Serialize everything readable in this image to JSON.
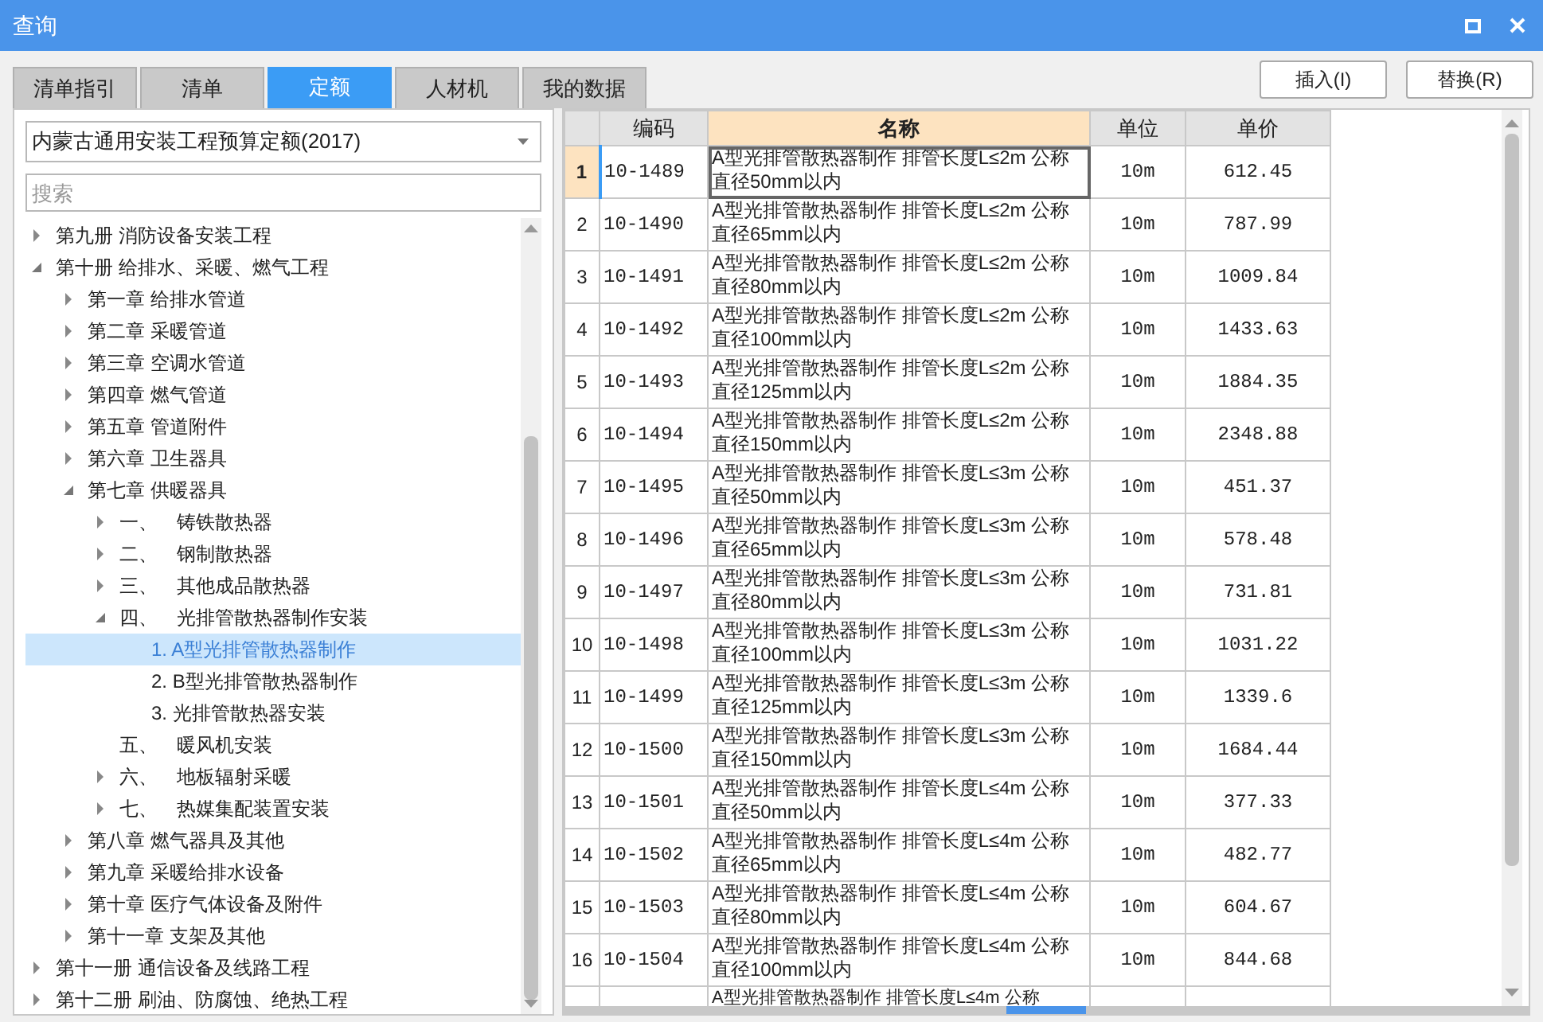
{
  "window": {
    "title": "查询"
  },
  "tabs": [
    {
      "label": "清单指引",
      "selected": false
    },
    {
      "label": "清单",
      "selected": false
    },
    {
      "label": "定额",
      "selected": true
    },
    {
      "label": "人材机",
      "selected": false
    },
    {
      "label": "我的数据",
      "selected": false
    }
  ],
  "buttons": [
    "插入(I)",
    "替换(R)"
  ],
  "library_select": {
    "value": "内蒙古通用安装工程预算定额(2017)"
  },
  "search": {
    "placeholder": "搜索"
  },
  "tree": [
    {
      "label": "第九册 消防设备安装工程",
      "expanded": false,
      "selected": false
    },
    {
      "label": "第十册 给排水、采暖、燃气工程",
      "expanded": true,
      "selected": false,
      "children": [
        {
          "label": "第一章 给排水管道",
          "expanded": false,
          "selected": false
        },
        {
          "label": "第二章 采暖管道",
          "expanded": false,
          "selected": false
        },
        {
          "label": "第三章 空调水管道",
          "expanded": false,
          "selected": false
        },
        {
          "label": "第四章 燃气管道",
          "expanded": false,
          "selected": false
        },
        {
          "label": "第五章 管道附件",
          "expanded": false,
          "selected": false
        },
        {
          "label": "第六章 卫生器具",
          "expanded": false,
          "selected": false
        },
        {
          "label": "第七章 供暖器具",
          "expanded": true,
          "selected": false,
          "children": [
            {
              "label": "一、　铸铁散热器",
              "expanded": false,
              "selected": false
            },
            {
              "label": "二、　钢制散热器",
              "expanded": false,
              "selected": false
            },
            {
              "label": "三、　其他成品散热器",
              "expanded": false,
              "selected": false
            },
            {
              "label": "四、　光排管散热器制作安装",
              "expanded": true,
              "selected": false,
              "children": [
                {
                  "label": "1. A型光排管散热器制作",
                  "selected": true
                },
                {
                  "label": "2. B型光排管散热器制作",
                  "selected": false
                },
                {
                  "label": "3. 光排管散热器安装",
                  "selected": false
                }
              ]
            },
            {
              "label": "五、　暖风机安装",
              "selected": false
            },
            {
              "label": "六、　地板辐射采暖",
              "expanded": false,
              "selected": false
            },
            {
              "label": "七、　热媒集配装置安装",
              "expanded": false,
              "selected": false
            }
          ]
        },
        {
          "label": "第八章 燃气器具及其他",
          "expanded": false,
          "selected": false
        },
        {
          "label": "第九章 采暖给排水设备",
          "expanded": false,
          "selected": false
        },
        {
          "label": "第十章 医疗气体设备及附件",
          "expanded": false,
          "selected": false
        },
        {
          "label": "第十一章 支架及其他",
          "expanded": false,
          "selected": false
        }
      ]
    },
    {
      "label": "第十一册 通信设备及线路工程",
      "expanded": false,
      "selected": false
    },
    {
      "label": "第十二册 刷油、防腐蚀、绝热工程",
      "expanded": false,
      "selected": false
    }
  ],
  "table": {
    "columns": [
      "编码",
      "名称",
      "单位",
      "单价"
    ],
    "rows": [
      {
        "no": "1",
        "code": "10-1489",
        "name": "A型光排管散热器制作 排管长度L≤2m 公称直径50mm以内",
        "unit": "10m",
        "price": "612.45",
        "selected": true
      },
      {
        "no": "2",
        "code": "10-1490",
        "name": "A型光排管散热器制作 排管长度L≤2m 公称直径65mm以内",
        "unit": "10m",
        "price": "787.99",
        "selected": false
      },
      {
        "no": "3",
        "code": "10-1491",
        "name": "A型光排管散热器制作 排管长度L≤2m 公称直径80mm以内",
        "unit": "10m",
        "price": "1009.84",
        "selected": false
      },
      {
        "no": "4",
        "code": "10-1492",
        "name": "A型光排管散热器制作 排管长度L≤2m 公称直径100mm以内",
        "unit": "10m",
        "price": "1433.63",
        "selected": false
      },
      {
        "no": "5",
        "code": "10-1493",
        "name": "A型光排管散热器制作 排管长度L≤2m 公称直径125mm以内",
        "unit": "10m",
        "price": "1884.35",
        "selected": false
      },
      {
        "no": "6",
        "code": "10-1494",
        "name": "A型光排管散热器制作 排管长度L≤2m 公称直径150mm以内",
        "unit": "10m",
        "price": "2348.88",
        "selected": false
      },
      {
        "no": "7",
        "code": "10-1495",
        "name": "A型光排管散热器制作 排管长度L≤3m 公称直径50mm以内",
        "unit": "10m",
        "price": "451.37",
        "selected": false
      },
      {
        "no": "8",
        "code": "10-1496",
        "name": "A型光排管散热器制作 排管长度L≤3m 公称直径65mm以内",
        "unit": "10m",
        "price": "578.48",
        "selected": false
      },
      {
        "no": "9",
        "code": "10-1497",
        "name": "A型光排管散热器制作 排管长度L≤3m 公称直径80mm以内",
        "unit": "10m",
        "price": "731.81",
        "selected": false
      },
      {
        "no": "10",
        "code": "10-1498",
        "name": "A型光排管散热器制作 排管长度L≤3m 公称直径100mm以内",
        "unit": "10m",
        "price": "1031.22",
        "selected": false
      },
      {
        "no": "11",
        "code": "10-1499",
        "name": "A型光排管散热器制作 排管长度L≤3m 公称直径125mm以内",
        "unit": "10m",
        "price": "1339.6",
        "selected": false
      },
      {
        "no": "12",
        "code": "10-1500",
        "name": "A型光排管散热器制作 排管长度L≤3m 公称直径150mm以内",
        "unit": "10m",
        "price": "1684.44",
        "selected": false
      },
      {
        "no": "13",
        "code": "10-1501",
        "name": "A型光排管散热器制作 排管长度L≤4m 公称直径50mm以内",
        "unit": "10m",
        "price": "377.33",
        "selected": false
      },
      {
        "no": "14",
        "code": "10-1502",
        "name": "A型光排管散热器制作 排管长度L≤4m 公称直径65mm以内",
        "unit": "10m",
        "price": "482.77",
        "selected": false
      },
      {
        "no": "15",
        "code": "10-1503",
        "name": "A型光排管散热器制作 排管长度L≤4m 公称直径80mm以内",
        "unit": "10m",
        "price": "604.67",
        "selected": false
      },
      {
        "no": "16",
        "code": "10-1504",
        "name": "A型光排管散热器制作 排管长度L≤4m 公称直径100mm以内",
        "unit": "10m",
        "price": "844.68",
        "selected": false
      },
      {
        "name": "A型光排管散热器制作 排管长度L≤4m 公称",
        "selected": false
      }
    ]
  }
}
